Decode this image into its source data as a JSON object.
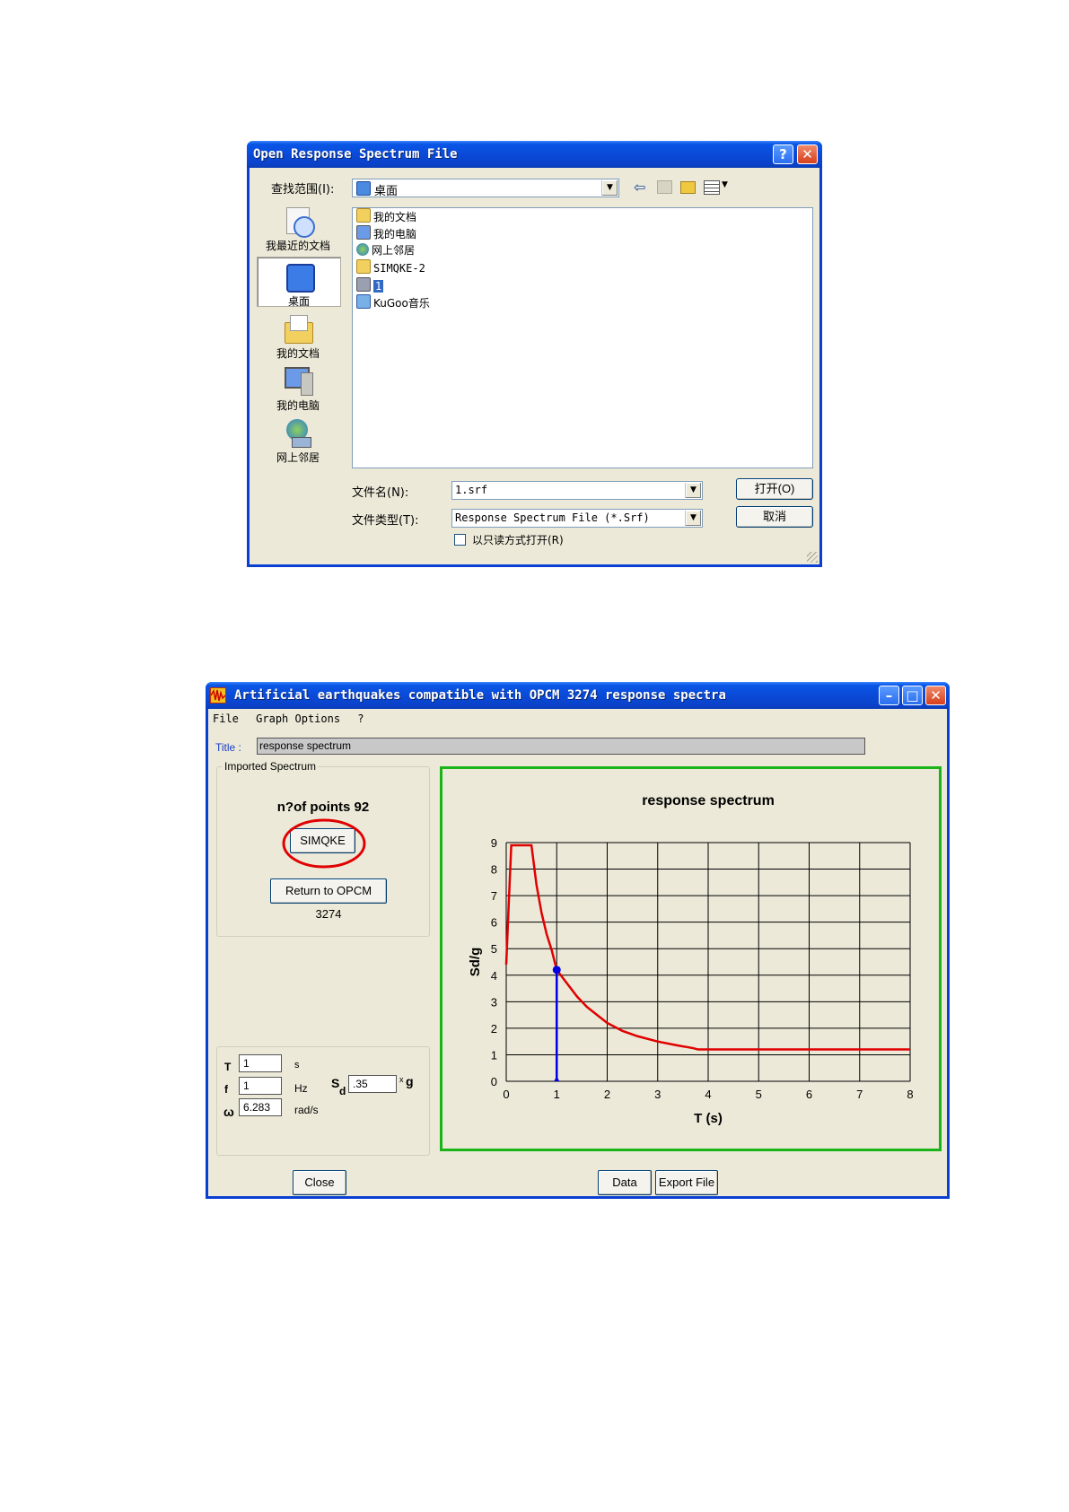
{
  "open_dialog": {
    "title": "Open Response Spectrum File",
    "help_btn": "?",
    "close_btn": "✕",
    "look_in_label": "查找范围(I):",
    "look_in_value": "桌面",
    "places": [
      {
        "label": "我最近的文档",
        "icon": "recent-documents-icon"
      },
      {
        "label": "桌面",
        "icon": "desktop-icon"
      },
      {
        "label": "我的文档",
        "icon": "my-documents-icon"
      },
      {
        "label": "我的电脑",
        "icon": "my-computer-icon"
      },
      {
        "label": "网上邻居",
        "icon": "network-icon"
      }
    ],
    "files": [
      "我的文档",
      "我的电脑",
      "网上邻居",
      "SIMQKE-2",
      "1",
      "KuGoo音乐"
    ],
    "filename_label": "文件名(N):",
    "filename_value": "1.srf",
    "filetype_label": "文件类型(T):",
    "filetype_value": "Response Spectrum File (*.Srf)",
    "readonly_label": "以只读方式打开(R)",
    "open_btn": "打开(O)",
    "cancel_btn": "取消"
  },
  "app": {
    "title": "Artificial earthquakes compatible with OPCM 3274 response spectra",
    "menu": [
      "File",
      "Graph Options",
      "?"
    ],
    "title_label": "Title :",
    "title_value": "response spectrum",
    "imported_group": "Imported Spectrum",
    "points_text": "n?of points 92",
    "simqke_btn": "SIMQKE",
    "return_btn": "Return to OPCM 3274",
    "T_label": "T",
    "T_value": "1",
    "T_unit": "s",
    "f_label": "f",
    "f_value": "1",
    "f_unit": "Hz",
    "w_label": "ω",
    "w_value": "6.283",
    "w_unit": "rad/s",
    "sd_label": "S",
    "sd_sub": "d",
    "sd_value": ".35",
    "sd_unit_x": "x",
    "sd_unit_g": "g",
    "close_btn": "Close",
    "data_btn": "Data",
    "export_btn": "Export File"
  },
  "chart_data": {
    "type": "line",
    "title": "response spectrum",
    "xlabel": "T (s)",
    "ylabel": "Sd/g",
    "xlim": [
      0,
      8
    ],
    "ylim": [
      0,
      9
    ],
    "xticks": [
      0,
      1,
      2,
      3,
      4,
      5,
      6,
      7,
      8
    ],
    "yticks": [
      0,
      1,
      2,
      3,
      4,
      5,
      6,
      7,
      8,
      9
    ],
    "grid": true,
    "series": [
      {
        "color": "#e00000",
        "x": [
          0,
          0.05,
          0.1,
          0.15,
          0.5,
          0.6,
          0.7,
          0.8,
          0.9,
          1.0,
          1.2,
          1.4,
          1.6,
          1.8,
          2.0,
          2.3,
          2.6,
          3.0,
          3.4,
          3.7,
          3.8,
          5,
          6,
          7,
          8
        ],
        "y": [
          4.4,
          6.7,
          8.9,
          8.9,
          8.9,
          7.4,
          6.35,
          5.55,
          4.95,
          4.2,
          3.7,
          3.2,
          2.8,
          2.5,
          2.2,
          1.9,
          1.7,
          1.5,
          1.35,
          1.25,
          1.2,
          1.2,
          1.2,
          1.2,
          1.2
        ]
      },
      {
        "color": "#0000e0",
        "x": [
          1,
          1
        ],
        "y": [
          0,
          4.2
        ]
      }
    ],
    "marker": {
      "x": 1,
      "y": 4.2,
      "color": "#0000e0"
    }
  }
}
